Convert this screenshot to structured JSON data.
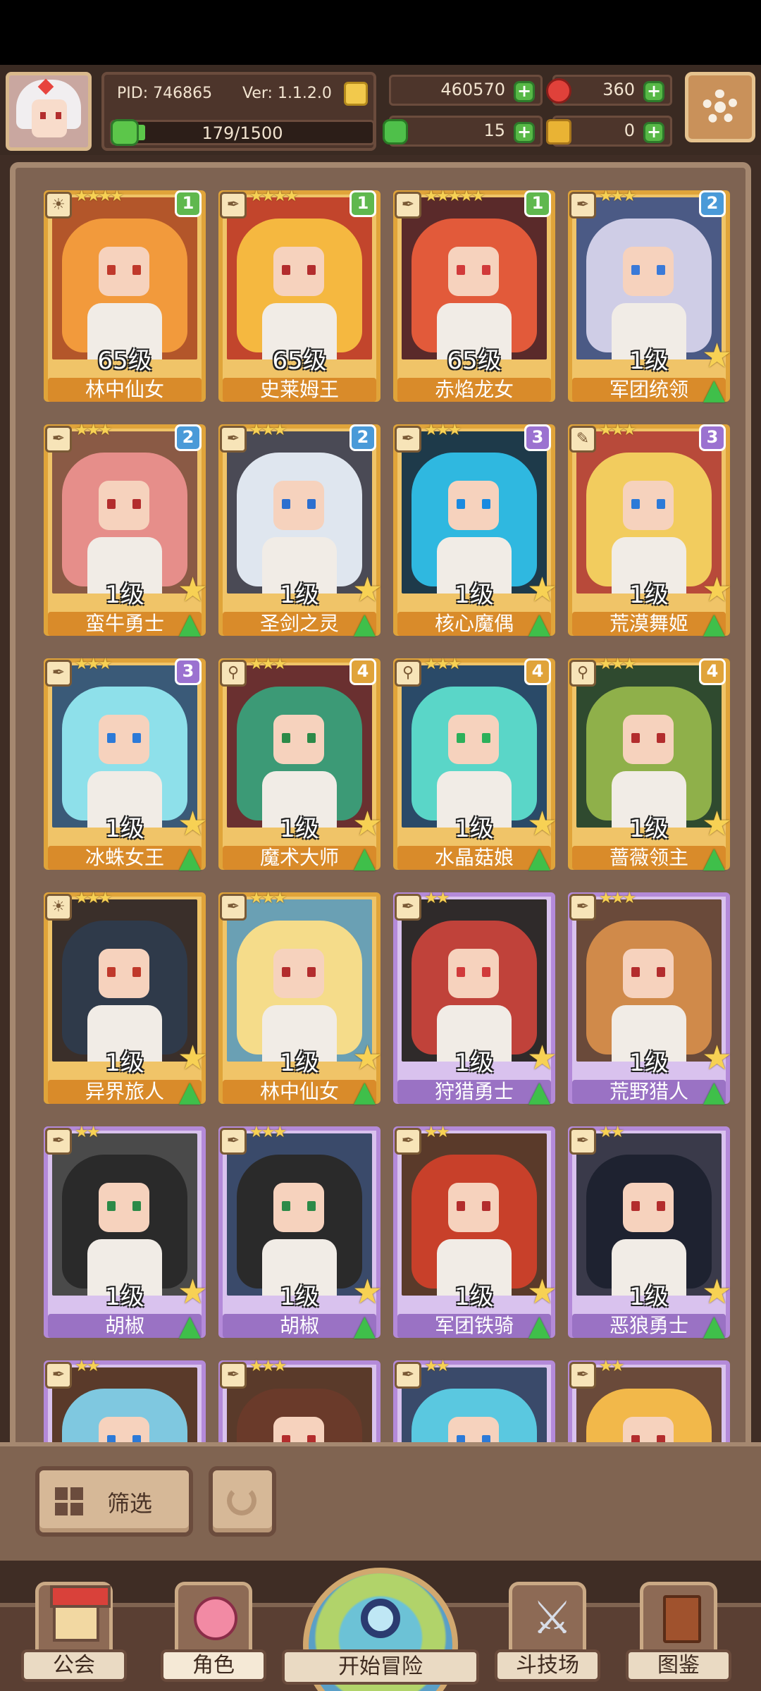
{
  "hud": {
    "pid": "PID: 746865",
    "version": "Ver: 1.1.2.0",
    "exp_text": "179/1500",
    "exp_progress": 0.119,
    "gold": "460570",
    "gems": "360",
    "clover": "15",
    "tickets": "0"
  },
  "cards": [
    {
      "name": "林中仙女",
      "level": "65级",
      "stars": "★★★★",
      "tier": "1",
      "frame": "gold",
      "type": "☀",
      "palette": {
        "bg": "#b3562a",
        "hair": "#f29a3c",
        "eye": "#c0392b"
      }
    },
    {
      "name": "史莱姆王",
      "level": "65级",
      "stars": "★★★★",
      "tier": "1",
      "frame": "gold",
      "type": "✒",
      "palette": {
        "bg": "#c2452c",
        "hair": "#f5b840",
        "eye": "#b32d2d"
      }
    },
    {
      "name": "赤焰龙女",
      "level": "65级",
      "stars": "★★★★★",
      "tier": "1",
      "frame": "gold",
      "type": "✒",
      "palette": {
        "bg": "#5a2a2a",
        "hair": "#e25a3a",
        "eye": "#d13a3a"
      }
    },
    {
      "name": "军团统领",
      "level": "1级",
      "stars": "★★★",
      "tier": "2",
      "frame": "gold",
      "type": "✒",
      "palette": {
        "bg": "#4b5a85",
        "hair": "#cfcde6",
        "eye": "#3a7ad8"
      }
    },
    {
      "name": "蛮牛勇士",
      "level": "1级",
      "stars": "★★★",
      "tier": "2",
      "frame": "gold",
      "type": "✒",
      "palette": {
        "bg": "#8a5a45",
        "hair": "#e68e8a",
        "eye": "#b32d2d"
      }
    },
    {
      "name": "圣剑之灵",
      "level": "1级",
      "stars": "★★★",
      "tier": "2",
      "frame": "gold",
      "type": "✒",
      "palette": {
        "bg": "#4a4a55",
        "hair": "#dfe6ef",
        "eye": "#2c6fcf"
      }
    },
    {
      "name": "核心魔偶",
      "level": "1级",
      "stars": "★★★",
      "tier": "3",
      "frame": "gold",
      "type": "✒",
      "palette": {
        "bg": "#1e3a4a",
        "hair": "#2fb8e0",
        "eye": "#1a8ae0"
      }
    },
    {
      "name": "荒漠舞姬",
      "level": "1级",
      "stars": "★★★",
      "tier": "3",
      "frame": "gold",
      "type": "✎",
      "palette": {
        "bg": "#b84a3a",
        "hair": "#f2cc5e",
        "eye": "#2c7ad8"
      }
    },
    {
      "name": "冰蛛女王",
      "level": "1级",
      "stars": "★★★",
      "tier": "3",
      "frame": "gold",
      "type": "✒",
      "palette": {
        "bg": "#3a5a78",
        "hair": "#8ee0ea",
        "eye": "#2c7ad8"
      }
    },
    {
      "name": "魔术大师",
      "level": "1级",
      "stars": "★★★",
      "tier": "4",
      "frame": "gold",
      "type": "⚲",
      "palette": {
        "bg": "#6a3030",
        "hair": "#3c9a76",
        "eye": "#2c8a48"
      }
    },
    {
      "name": "水晶菇娘",
      "level": "1级",
      "stars": "★★★",
      "tier": "4",
      "frame": "gold",
      "type": "⚲",
      "palette": {
        "bg": "#2a4a68",
        "hair": "#5ad6c8",
        "eye": "#2cb05a"
      }
    },
    {
      "name": "蔷薇领主",
      "level": "1级",
      "stars": "★★★",
      "tier": "4",
      "frame": "gold",
      "type": "⚲",
      "palette": {
        "bg": "#2f4a2f",
        "hair": "#8fb04a",
        "eye": "#b32d2d"
      }
    },
    {
      "name": "异界旅人",
      "level": "1级",
      "stars": "★★★",
      "tier": "",
      "frame": "gold",
      "type": "☀",
      "palette": {
        "bg": "#3a2f2a",
        "hair": "#2f3a4a",
        "eye": "#c0392b"
      }
    },
    {
      "name": "林中仙女",
      "level": "1级",
      "stars": "★★★",
      "tier": "",
      "frame": "gold",
      "type": "✒",
      "palette": {
        "bg": "#6aa0b4",
        "hair": "#f5dc8a",
        "eye": "#b32d2d"
      }
    },
    {
      "name": "狩猎勇士",
      "level": "1级",
      "stars": "★★",
      "tier": "",
      "frame": "purple",
      "type": "✒",
      "palette": {
        "bg": "#2f2a2a",
        "hair": "#c0423a",
        "eye": "#d13a3a"
      }
    },
    {
      "name": "荒野猎人",
      "level": "1级",
      "stars": "★★★",
      "tier": "",
      "frame": "purple",
      "type": "✒",
      "palette": {
        "bg": "#6a4a3a",
        "hair": "#d08a4a",
        "eye": "#b32d2d"
      }
    },
    {
      "name": "胡椒",
      "level": "1级",
      "stars": "★★",
      "tier": "",
      "frame": "purple",
      "type": "✒",
      "palette": {
        "bg": "#4a4a4a",
        "hair": "#2a2a2a",
        "eye": "#2c8a48"
      }
    },
    {
      "name": "胡椒",
      "level": "1级",
      "stars": "★★★",
      "tier": "",
      "frame": "purple",
      "type": "✒",
      "palette": {
        "bg": "#3a4a6a",
        "hair": "#2a2a2a",
        "eye": "#2c8a48"
      }
    },
    {
      "name": "军团铁骑",
      "level": "1级",
      "stars": "★★",
      "tier": "",
      "frame": "purple",
      "type": "✒",
      "palette": {
        "bg": "#5a3a2a",
        "hair": "#c8402a",
        "eye": "#b32d2d"
      }
    },
    {
      "name": "恶狼勇士",
      "level": "1级",
      "stars": "★★",
      "tier": "",
      "frame": "purple",
      "type": "✒",
      "palette": {
        "bg": "#3a3a4a",
        "hair": "#1e2230",
        "eye": "#b32d2d"
      }
    },
    {
      "name": "",
      "level": "",
      "stars": "★★",
      "tier": "",
      "frame": "purple",
      "type": "✒",
      "palette": {
        "bg": "#5a3a2a",
        "hair": "#7fc8e0",
        "eye": "#2c7ad8"
      }
    },
    {
      "name": "",
      "level": "",
      "stars": "★★★",
      "tier": "",
      "frame": "purple",
      "type": "✒",
      "palette": {
        "bg": "#5a3a2a",
        "hair": "#6a3a2a",
        "eye": "#b32d2d"
      }
    },
    {
      "name": "",
      "level": "",
      "stars": "★★",
      "tier": "",
      "frame": "purple",
      "type": "✒",
      "palette": {
        "bg": "#3a4a6a",
        "hair": "#5ac8e0",
        "eye": "#2c7ad8"
      }
    },
    {
      "name": "",
      "level": "",
      "stars": "★★",
      "tier": "",
      "frame": "purple",
      "type": "✒",
      "palette": {
        "bg": "#6a4a3a",
        "hair": "#f2b84a",
        "eye": "#b32d2d"
      }
    }
  ],
  "filter": {
    "label": "筛选"
  },
  "nav": {
    "guild": "公会",
    "character": "角色",
    "adventure": "开始冒险",
    "arena": "斗技场",
    "codex": "图鉴"
  }
}
